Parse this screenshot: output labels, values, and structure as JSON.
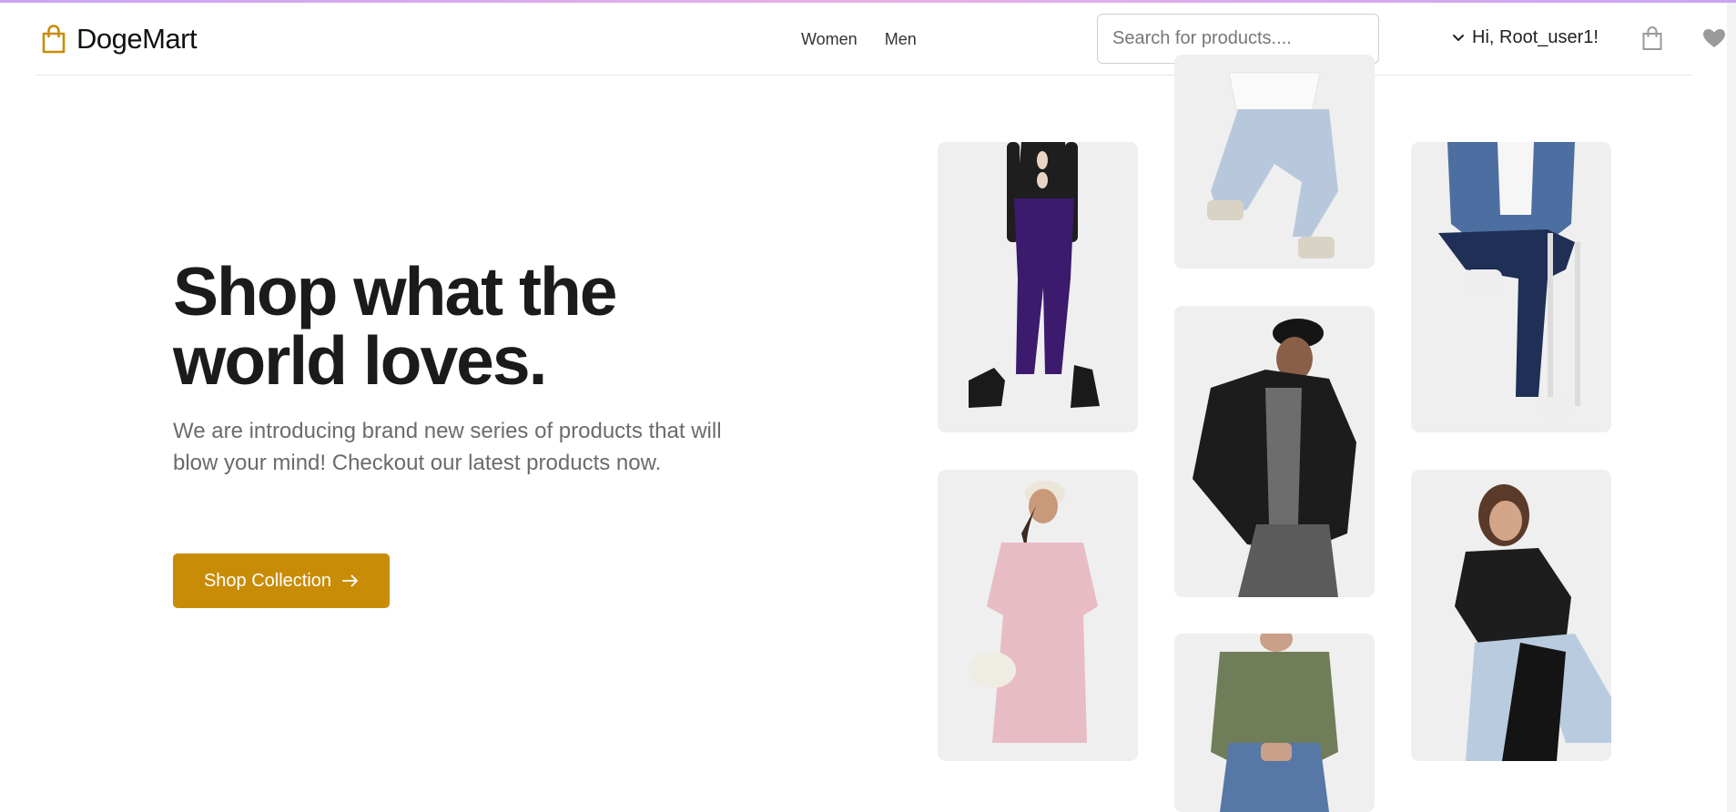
{
  "brand": {
    "name": "DogeMart",
    "accent_color": "#c98c06",
    "logo_icon": "shopping-bag-icon"
  },
  "nav": {
    "items": [
      {
        "label": "Women"
      },
      {
        "label": "Men"
      }
    ]
  },
  "search": {
    "placeholder": "Search for products....",
    "value": ""
  },
  "user": {
    "greeting": "Hi, Root_user1!",
    "menu_icon": "chevron-down-icon"
  },
  "actions": {
    "cart_icon": "shopping-bag-icon",
    "wishlist_icon": "heart-icon"
  },
  "hero": {
    "title_line1": "Shop what the",
    "title_line2": "world loves.",
    "subtitle": "We are introducing brand new series of products that will blow your mind! Checkout our latest products now.",
    "cta_label": "Shop Collection",
    "cta_icon": "arrow-right-icon"
  },
  "product_tiles": [
    {
      "name": "purple-jeans-outfit"
    },
    {
      "name": "light-jeans-crouch"
    },
    {
      "name": "denim-shirt-seated"
    },
    {
      "name": "leather-jacket-cap"
    },
    {
      "name": "pink-smock-dress"
    },
    {
      "name": "leather-jacket-sitting"
    },
    {
      "name": "plaid-shirt-jeans"
    }
  ]
}
